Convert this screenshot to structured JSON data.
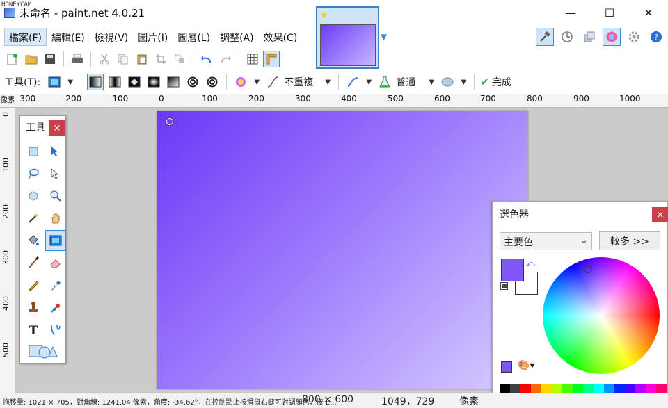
{
  "watermark": "HONEYCAM",
  "window": {
    "title": "未命名 - paint.net 4.0.21",
    "minimize": "—",
    "maximize": "☐",
    "close": "✕"
  },
  "menu": [
    {
      "label": "檔案(F)"
    },
    {
      "label": "編輯(E)"
    },
    {
      "label": "檢視(V)"
    },
    {
      "label": "圖片(I)"
    },
    {
      "label": "圖層(L)"
    },
    {
      "label": "調整(A)"
    },
    {
      "label": "效果(C)"
    }
  ],
  "toolbar2": {
    "tool_label": "工具(T):",
    "repeat_label": "不重複",
    "blend_label": "普通",
    "finish_label": "完成"
  },
  "ruler": {
    "unit_corner": "像素",
    "h_ticks": [
      "-300",
      "-200",
      "-100",
      "0",
      "100",
      "200",
      "300",
      "400",
      "500",
      "600",
      "700",
      "800",
      "900",
      "1000"
    ],
    "v_ticks": [
      "0",
      "100",
      "200",
      "300",
      "400",
      "500"
    ]
  },
  "tools_window": {
    "title": "工具",
    "close": "×"
  },
  "color_window": {
    "title": "選色器",
    "close": "×",
    "select_value": "主要色",
    "more_button": "較多 >>",
    "primary_color": "#7f57f7",
    "secondary_color": "#ffffff",
    "palette": [
      "#000000",
      "#404040",
      "#ff0000",
      "#ff6a00",
      "#ffd800",
      "#b6ff00",
      "#4cff00",
      "#00ff21",
      "#00ff90",
      "#00ffff",
      "#0094ff",
      "#0026ff",
      "#4800ff",
      "#b200ff",
      "#ff00dc",
      "#ff006e"
    ]
  },
  "status": {
    "hint": "拖移量: 1021 × 705，對角線: 1241.04 像素，角度: -34.62°，在控制點上按滑鼠右鍵可對調顏色，按 E...",
    "image_size": "800 × 600",
    "cursor_pos": "1049，729",
    "unit": "像素"
  }
}
